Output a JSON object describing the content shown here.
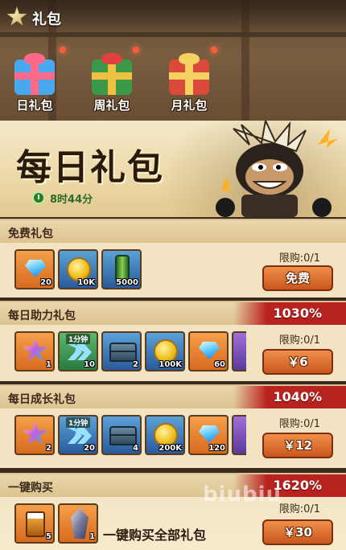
{
  "header": {
    "title": "礼包"
  },
  "tabs": [
    {
      "label": "日礼包",
      "active": true
    },
    {
      "label": "周礼包",
      "active": false
    },
    {
      "label": "月礼包",
      "active": false
    }
  ],
  "banner": {
    "title": "每日礼包",
    "timer": "8时44分"
  },
  "packs": [
    {
      "name": "免费礼包",
      "percent": "",
      "items": [
        {
          "icon": "diamond-icon",
          "qty": "20"
        },
        {
          "icon": "gold-coin-icon",
          "qty": "10K"
        },
        {
          "icon": "green-can-icon",
          "qty": "5000"
        }
      ],
      "limit": "限购:0/1",
      "button": "免费"
    },
    {
      "name": "每日助力礼包",
      "percent": "1030%",
      "items": [
        {
          "icon": "star-crystal-icon",
          "qty": "1"
        },
        {
          "icon": "speedup-icon",
          "qty": "10",
          "tag": "1分钟"
        },
        {
          "icon": "chest-icon",
          "qty": "2"
        },
        {
          "icon": "gold-coin-icon",
          "qty": "100K"
        },
        {
          "icon": "diamond-icon",
          "qty": "60"
        }
      ],
      "limit": "限购:0/1",
      "button": "￥6"
    },
    {
      "name": "每日成长礼包",
      "percent": "1040%",
      "items": [
        {
          "icon": "star-crystal-icon",
          "qty": "2"
        },
        {
          "icon": "speedup-icon",
          "qty": "20",
          "tag": "1分钟"
        },
        {
          "icon": "chest-icon",
          "qty": "4"
        },
        {
          "icon": "gold-coin-icon",
          "qty": "200K"
        },
        {
          "icon": "diamond-icon",
          "qty": "120"
        }
      ],
      "limit": "限购:0/1",
      "button": "￥12"
    },
    {
      "name": "一键购买",
      "percent": "1620%",
      "items": [
        {
          "icon": "beer-icon",
          "qty": "5"
        },
        {
          "icon": "crystal-icon",
          "qty": "1"
        }
      ],
      "description": "一键购买全部礼包",
      "limit": "限购:0/1",
      "button": "￥30"
    }
  ],
  "watermark": "biubiu"
}
